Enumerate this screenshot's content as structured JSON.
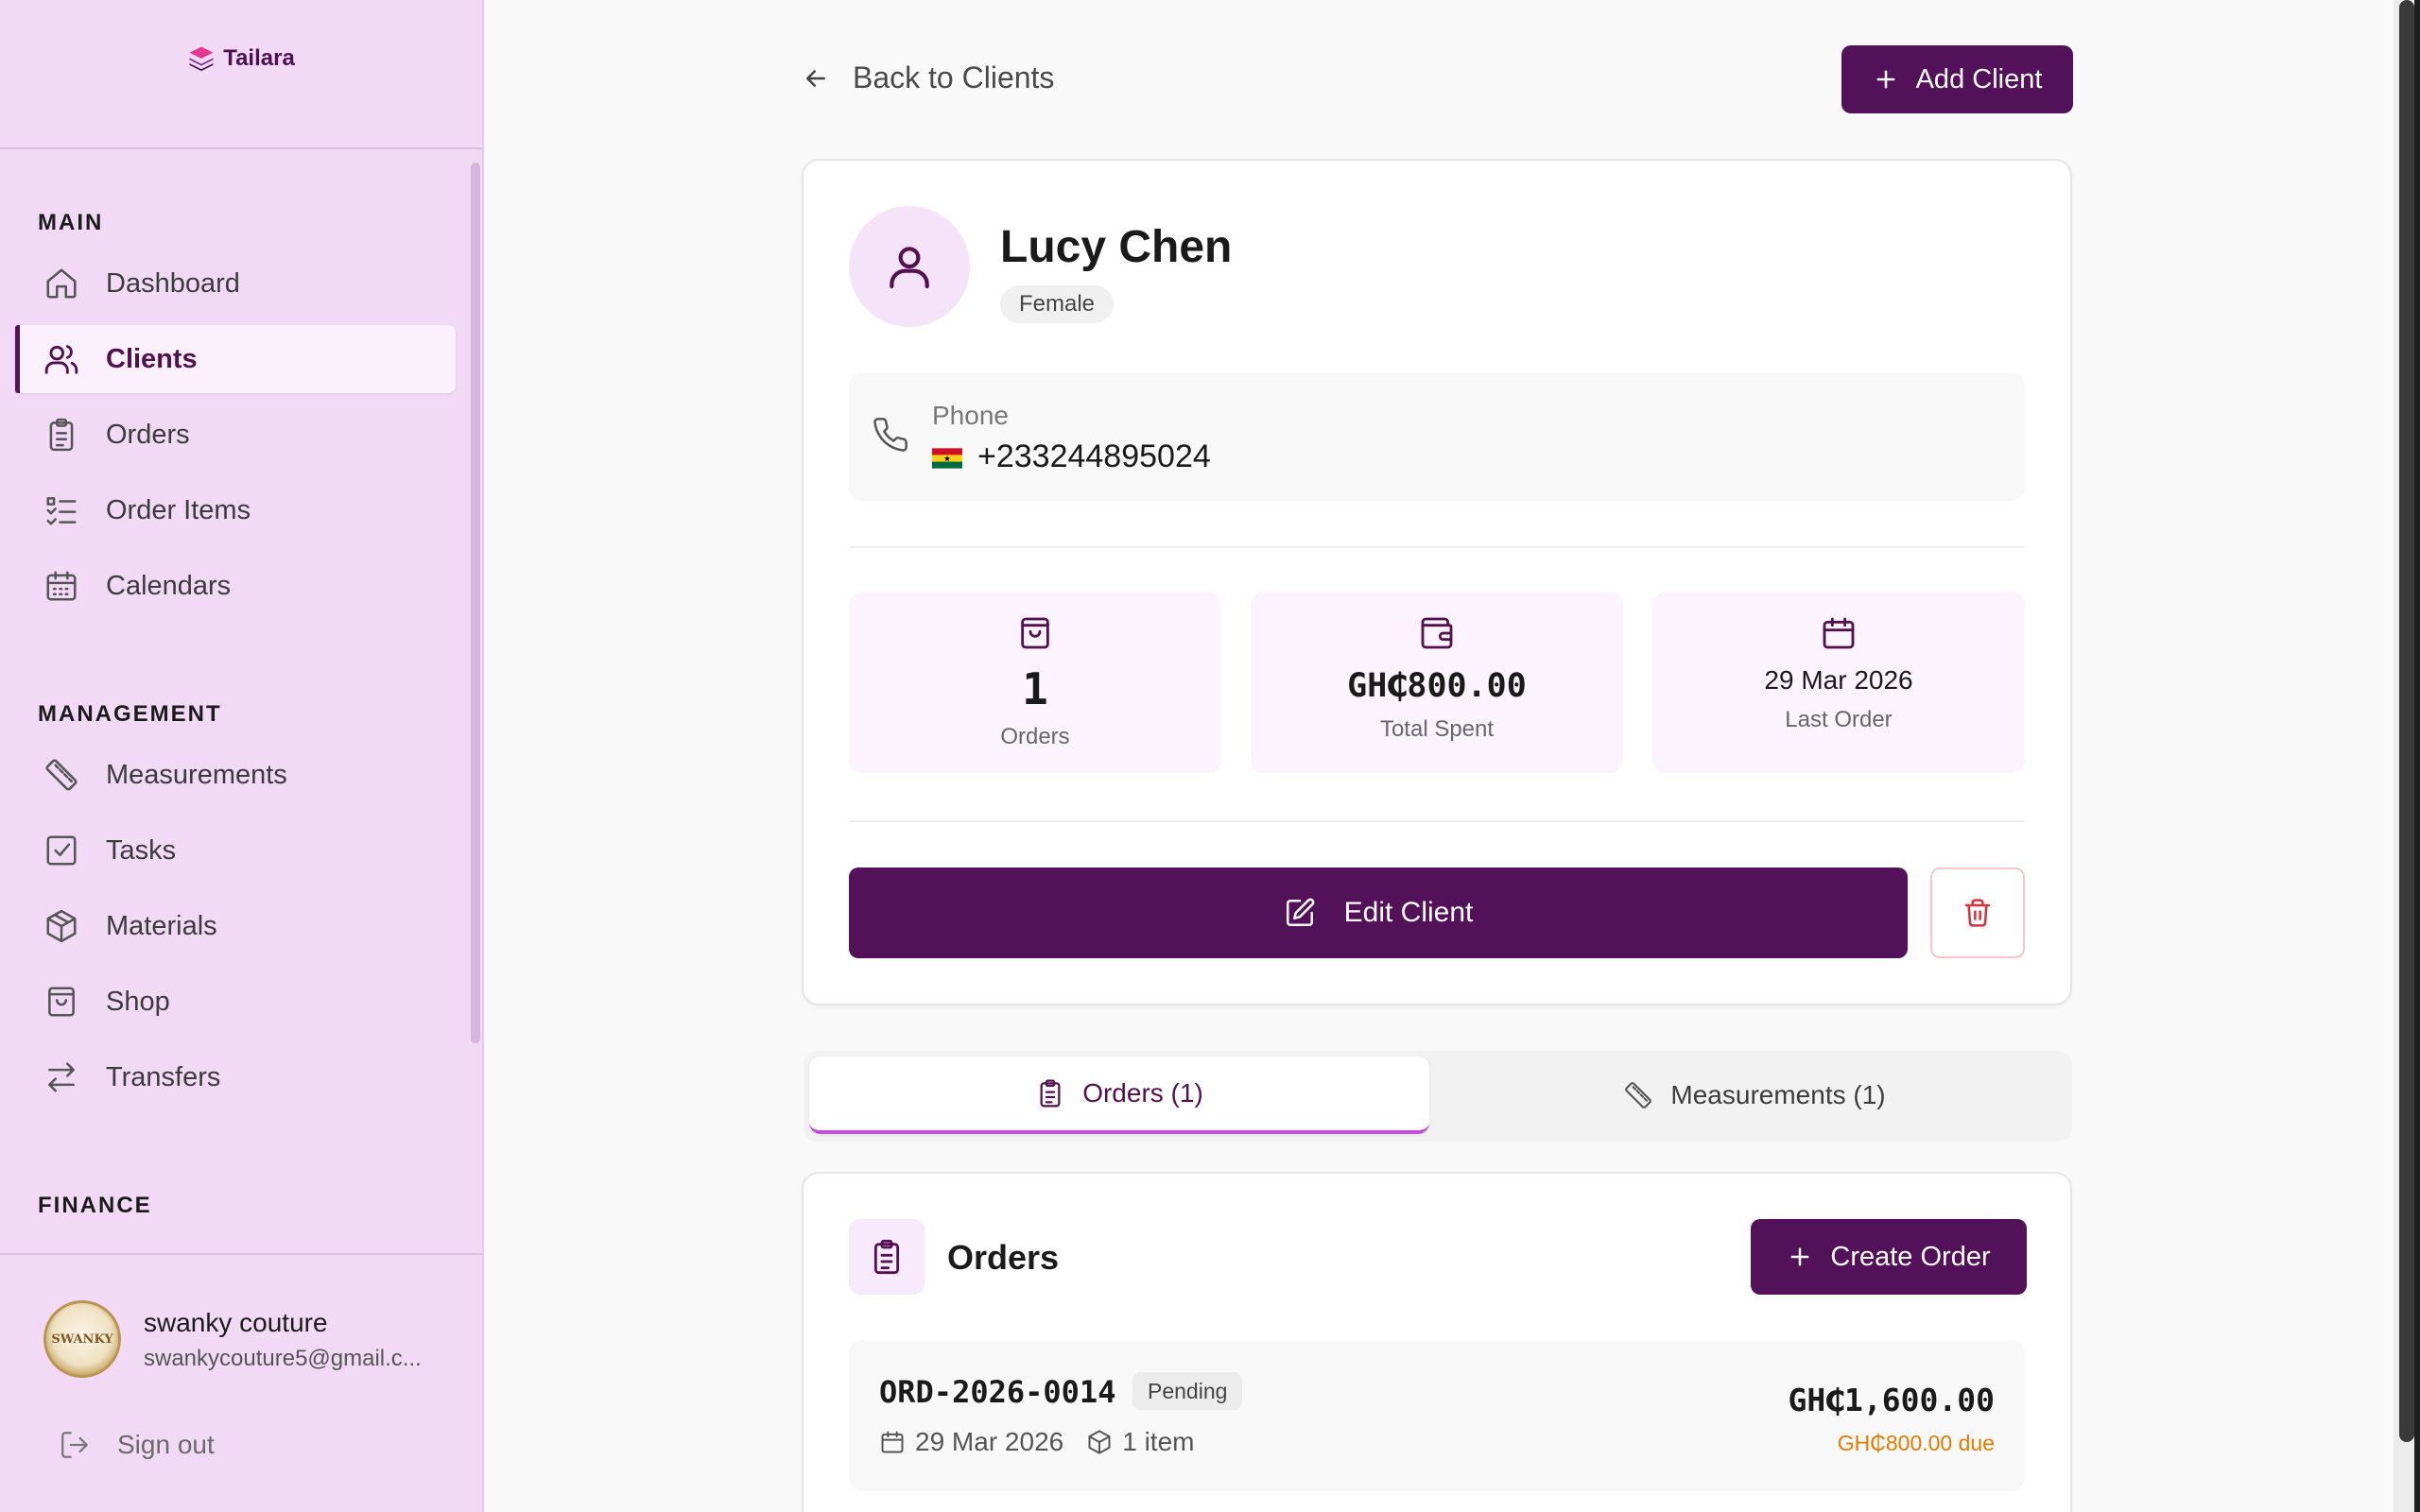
{
  "brand": {
    "name": "Tailara"
  },
  "sidebar": {
    "sections": [
      {
        "title": "MAIN",
        "items": [
          {
            "label": "Dashboard",
            "icon": "home-icon"
          },
          {
            "label": "Clients",
            "icon": "users-icon",
            "active": true
          },
          {
            "label": "Orders",
            "icon": "clipboard-icon"
          },
          {
            "label": "Order Items",
            "icon": "list-check-icon"
          },
          {
            "label": "Calendars",
            "icon": "calendar-icon"
          }
        ]
      },
      {
        "title": "MANAGEMENT",
        "items": [
          {
            "label": "Measurements",
            "icon": "ruler-icon"
          },
          {
            "label": "Tasks",
            "icon": "check-square-icon"
          },
          {
            "label": "Materials",
            "icon": "box-icon"
          },
          {
            "label": "Shop",
            "icon": "shopping-bag-icon"
          },
          {
            "label": "Transfers",
            "icon": "arrows-swap-icon"
          }
        ]
      },
      {
        "title": "FINANCE",
        "items": []
      }
    ],
    "user": {
      "name": "swanky couture",
      "email": "swankycouture5@gmail.c...",
      "avatar_text": "SWANKY"
    },
    "signout_label": "Sign out"
  },
  "header": {
    "back_label": "Back to Clients",
    "add_client_label": "Add Client"
  },
  "client": {
    "name": "Lucy Chen",
    "gender": "Female",
    "phone_label": "Phone",
    "phone": "+233244895024",
    "stats": {
      "orders_value": "1",
      "orders_label": "Orders",
      "spent_value": "GH₵800.00",
      "spent_label": "Total Spent",
      "last_order_value": "29 Mar 2026",
      "last_order_label": "Last Order"
    },
    "edit_label": "Edit Client"
  },
  "tabs": [
    {
      "label": "Orders (1)",
      "active": true
    },
    {
      "label": "Measurements (1)",
      "active": false
    }
  ],
  "orders": {
    "title": "Orders",
    "create_label": "Create Order",
    "rows": [
      {
        "id": "ORD-2026-0014",
        "status": "Pending",
        "date": "29 Mar 2026",
        "items": "1 item",
        "total": "GH₵1,600.00",
        "due": "GH₵800.00 due"
      }
    ]
  },
  "colors": {
    "brand_primary": "#53115a",
    "sidebar_bg": "#f2daf7",
    "tab_accent": "#c34fd9",
    "due_orange": "#e07c00",
    "danger": "#d9303e"
  }
}
